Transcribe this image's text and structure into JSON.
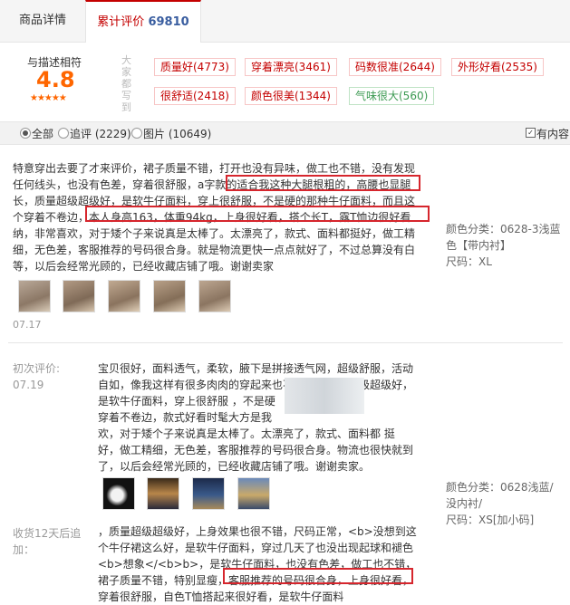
{
  "tabs": {
    "details": "商品详情",
    "reviews_label": "累计评价",
    "reviews_count": "69810"
  },
  "rating": {
    "label": "与描述相符",
    "score": "4.8",
    "stars": "★★★★★",
    "tags_title": "大家都写到"
  },
  "tags": [
    {
      "text": "质量好(4773)",
      "kind": "good-red"
    },
    {
      "text": "穿着漂亮(3461)",
      "kind": "good-red"
    },
    {
      "text": "码数很准(2644)",
      "kind": "good-red"
    },
    {
      "text": "外形好看(2535)",
      "kind": "good-red"
    },
    {
      "text": "很舒适(2418)",
      "kind": "good-red"
    },
    {
      "text": "颜色很美(1344)",
      "kind": "good-red"
    },
    {
      "text": "气味很大(560)",
      "kind": "neutral-green"
    }
  ],
  "filter": {
    "all": "全部",
    "followup": "追评 (2229)",
    "pictures": "图片 (10649)",
    "has_content": "有内容"
  },
  "review1": {
    "lines": [
      "特意穿出去要了才来评价，裙子质量不错，打开也没有异味，做工也不错，没有发现",
      "任何线头，也没有色差，穿着很舒服，a字款的适合我这种大腿根粗的，高腰也显腿",
      "长，质量超级超级好，是软牛仔面料，穿上很舒服，不是硬的那种牛仔面料，而且这",
      "个穿着不卷边，本人身高163，体重94kg，上身很好看，搭个长T，露T恤边很好看",
      "纳，非常喜欢，对于矮个子来说真是太棒了。太漂亮了，款式、面料都挺好，做工精",
      "细，无色差，客服推荐的号码很合身。就是物流更快一点点就好了，不过总算没有白",
      "等，以后会经常光顾的，已经收藏店铺了哦。谢谢卖家"
    ],
    "spec_color": "颜色分类：0628-3浅蓝",
    "spec_color2": "色【带内衬】",
    "spec_size": "尺码：XL",
    "date": "07.17"
  },
  "review2": {
    "first_label": "初次评价:",
    "first_date": "07.19",
    "lines": [
      "宝贝很好，面料透气，柔软，腋下是拼接透气网，超级舒服，活动",
      "自如，像我这样有很多肉肉的穿起来也不紧绷，质量超级超级好，",
      "是软牛仔面料，穿上很舒服 ，不是硬",
      "穿着不卷边，款式好看时髦大方是我",
      "欢，对于矮个子来说真是太棒了。太漂亮了，款式、面料都 挺",
      "好，做工精细，无色差，客服推荐的号码很合身。物流也很快就到",
      "了，以后会经常光顾的，已经收藏店铺了哦。谢谢卖家。"
    ],
    "spec_color": "颜色分类：0628浅蓝/",
    "spec_color2": "没内衬/",
    "spec_size": "尺码：XS[加小码]"
  },
  "review3": {
    "label_line1": "收货12天后追",
    "label_line2": "加：",
    "lines": [
      "，质量超级超级好，上身效果也很不错，尺码正常，<b>没想到这",
      "个牛仔裙这么好，是软牛仔面料，穿过几天了也没出现起球和褪色",
      "<b>想象</<b>b>，是软牛仔面料，也没有色差，做工也不错，",
      "裙子质量不错，特别显瘦，客服推荐的号码很合身，上身很好看，",
      "穿着很舒服，自色T恤搭起来很好看，是软牛仔面料"
    ]
  }
}
